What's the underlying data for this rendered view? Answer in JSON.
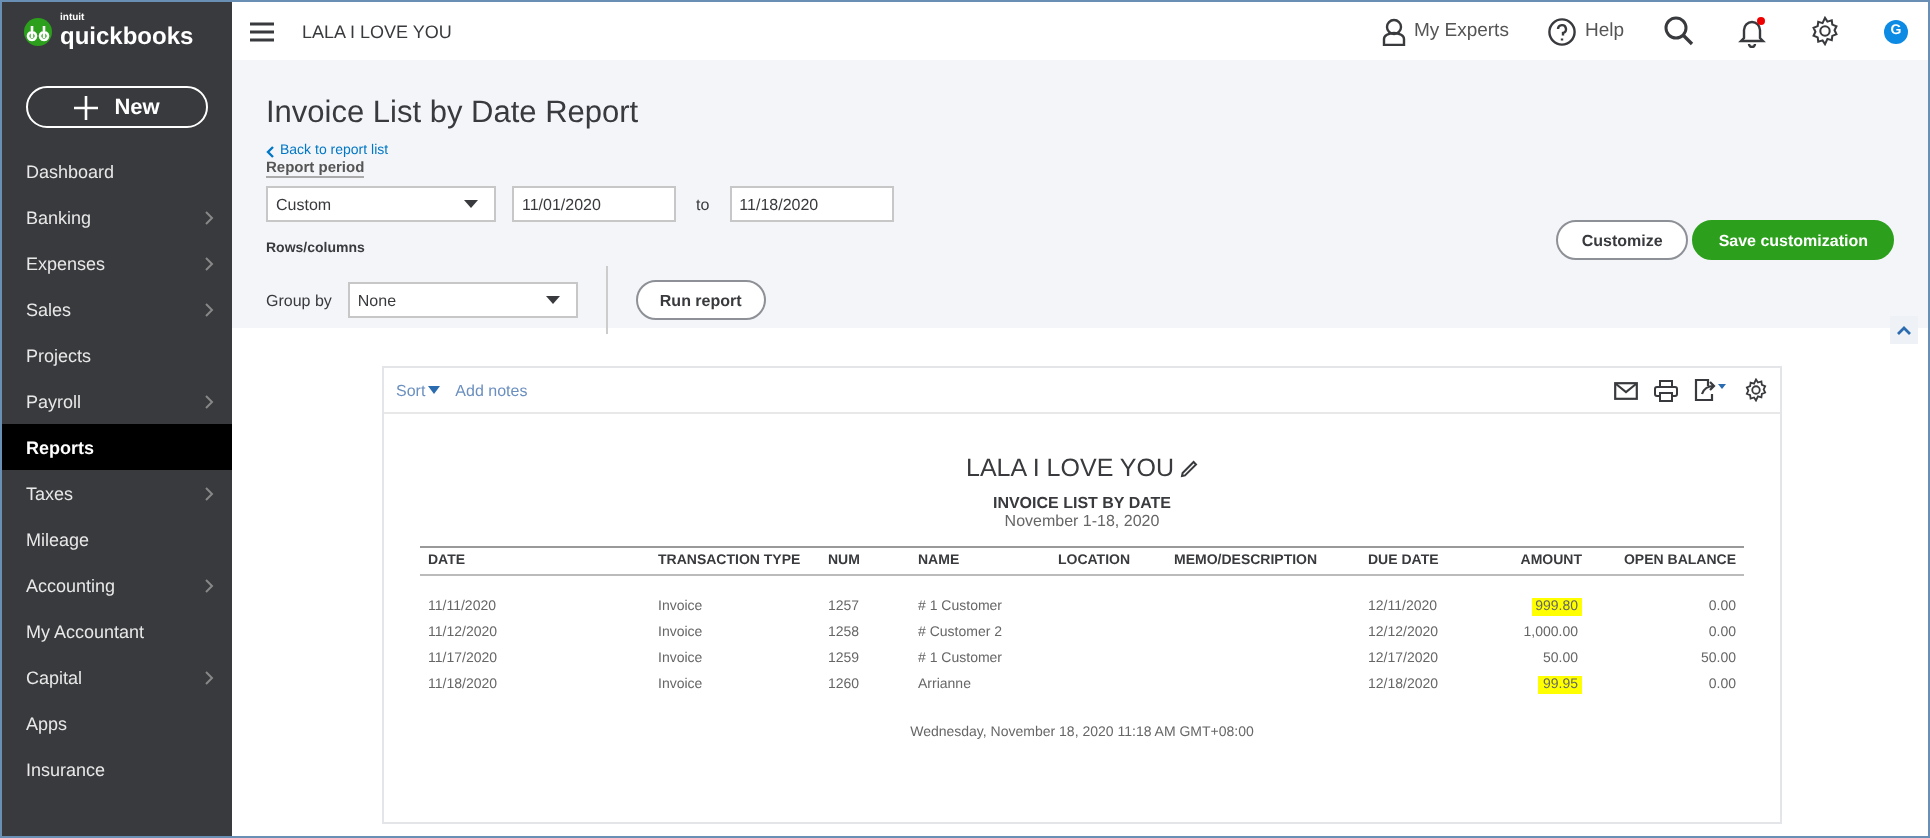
{
  "brand": {
    "small": "intuit",
    "name": "quickbooks"
  },
  "new_button": "New",
  "sidebar": {
    "items": [
      {
        "label": "Dashboard",
        "selected": false,
        "has_submenu": false
      },
      {
        "label": "Banking",
        "selected": false,
        "has_submenu": true
      },
      {
        "label": "Expenses",
        "selected": false,
        "has_submenu": true
      },
      {
        "label": "Sales",
        "selected": false,
        "has_submenu": true
      },
      {
        "label": "Projects",
        "selected": false,
        "has_submenu": false
      },
      {
        "label": "Payroll",
        "selected": false,
        "has_submenu": true
      },
      {
        "label": "Reports",
        "selected": true,
        "has_submenu": false
      },
      {
        "label": "Taxes",
        "selected": false,
        "has_submenu": true
      },
      {
        "label": "Mileage",
        "selected": false,
        "has_submenu": false
      },
      {
        "label": "Accounting",
        "selected": false,
        "has_submenu": true
      },
      {
        "label": "My Accountant",
        "selected": false,
        "has_submenu": false
      },
      {
        "label": "Capital",
        "selected": false,
        "has_submenu": true
      },
      {
        "label": "Apps",
        "selected": false,
        "has_submenu": false
      },
      {
        "label": "Insurance",
        "selected": false,
        "has_submenu": false
      }
    ]
  },
  "topbar": {
    "company": "LALA I LOVE YOU",
    "experts": "My Experts",
    "help": "Help",
    "avatar": "G",
    "notification": true
  },
  "header": {
    "title": "Invoice List by Date Report",
    "back_link": "Back to report list",
    "period_label": "Report period",
    "period": "Custom",
    "from": "11/01/2020",
    "to_label": "to",
    "to": "11/18/2020",
    "rows_columns": "Rows/columns",
    "group_by_label": "Group by",
    "group_by": "None",
    "run": "Run report",
    "customize": "Customize",
    "save": "Save customization"
  },
  "report": {
    "sort": "Sort",
    "add_notes": "Add notes",
    "company": "LALA I LOVE YOU",
    "title": "INVOICE LIST BY DATE",
    "period": "November 1-18, 2020",
    "columns": [
      "DATE",
      "TRANSACTION TYPE",
      "NUM",
      "NAME",
      "LOCATION",
      "MEMO/DESCRIPTION",
      "DUE DATE",
      "AMOUNT",
      "OPEN BALANCE"
    ],
    "rows": [
      {
        "date": "11/11/2020",
        "type": "Invoice",
        "num": "1257",
        "name": "# 1 Customer",
        "due": "12/11/2020",
        "amount": "999.80",
        "balance": "0.00",
        "highlighted": true
      },
      {
        "date": "11/12/2020",
        "type": "Invoice",
        "num": "1258",
        "name": "# Customer 2",
        "due": "12/12/2020",
        "amount": "1,000.00",
        "balance": "0.00",
        "highlighted": false
      },
      {
        "date": "11/17/2020",
        "type": "Invoice",
        "num": "1259",
        "name": "# 1 Customer",
        "due": "12/17/2020",
        "amount": "50.00",
        "balance": "50.00",
        "highlighted": false
      },
      {
        "date": "11/18/2020",
        "type": "Invoice",
        "num": "1260",
        "name": "Arrianne",
        "due": "12/18/2020",
        "amount": "99.95",
        "balance": "0.00",
        "highlighted": true
      }
    ],
    "footer": "Wednesday, November 18, 2020  11:18 AM GMT+08:00"
  }
}
